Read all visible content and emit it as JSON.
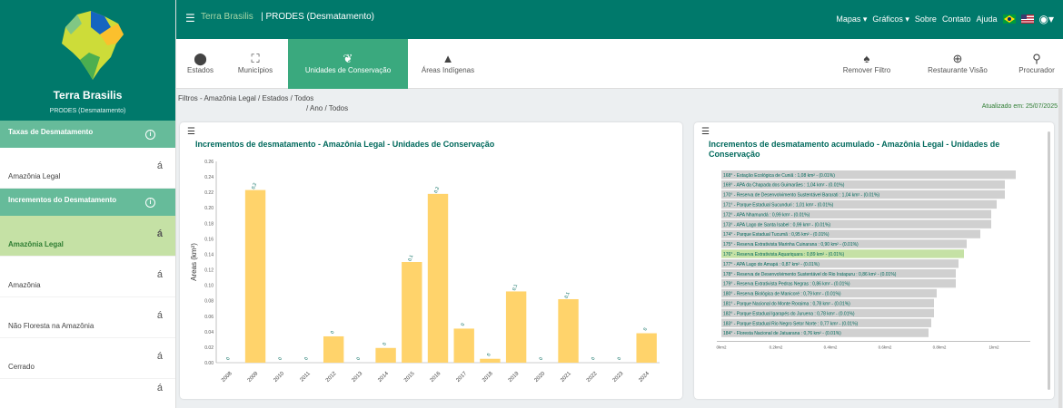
{
  "brand": {
    "name": "Terra Brasilis",
    "subtitle": "PRODES (Desmatamento)"
  },
  "topbar": {
    "title_part1": "Terra Brasilis",
    "title_part2": "| PRODES (Desmatamento)",
    "menu": [
      "Mapas ▾",
      "Gráficos ▾",
      "Sobre",
      "Contato",
      "Ajuda"
    ]
  },
  "toolbar": {
    "left": [
      {
        "icon": "pin-icon",
        "label": "Estados"
      },
      {
        "icon": "municipality-icon",
        "label": "Municípios"
      },
      {
        "icon": "leaf-icon",
        "label": "Unidades de Conservação"
      },
      {
        "icon": "tent-icon",
        "label": "Áreas Indígenas"
      }
    ],
    "right": [
      {
        "icon": "bell-icon",
        "label": "Remover Filtro"
      },
      {
        "icon": "globe-icon",
        "label": "Restaurante Visão"
      },
      {
        "icon": "search-icon",
        "label": "Procurador"
      }
    ]
  },
  "filters": {
    "line1": "Filtros - Amazônia Legal / Estados / Todos",
    "line2": "/ Ano / Todos",
    "updated": "Atualizado em: 25/07/2025"
  },
  "sidebar": {
    "section1": "Taxas de Desmatamento",
    "section1_items": [
      "Amazônia Legal"
    ],
    "section2": "Incrementos do Desmatamento",
    "section2_items": [
      "Amazônia Legal",
      "Amazônia",
      "Não Floresta na Amazônia",
      "Cerrado"
    ],
    "acc": "á"
  },
  "chart_data": [
    {
      "type": "bar",
      "title": "Incrementos de desmatamento - Amazônia Legal - Unidades de Conservação",
      "ylabel": "Areas (km²)",
      "ylim": [
        0,
        0.26
      ],
      "yticks": [
        "0.00",
        "0.02",
        "0.04",
        "0.06",
        "0.08",
        "0.10",
        "0.12",
        "0.14",
        "0.16",
        "0.18",
        "0.20",
        "0.22",
        "0.24",
        "0.26"
      ],
      "categories": [
        "2008",
        "2009",
        "2010",
        "2011",
        "2012",
        "2013",
        "2014",
        "2015",
        "2016",
        "2017",
        "2018",
        "2019",
        "2020",
        "2021",
        "2022",
        "2023",
        "2024"
      ],
      "values": [
        0,
        0.223,
        0,
        0,
        0.034,
        0,
        0.019,
        0.13,
        0.218,
        0.044,
        0.005,
        0.092,
        0,
        0.082,
        0,
        0,
        0.038
      ],
      "data_labels": [
        "0",
        "0,2",
        "0",
        "0",
        "0",
        "0",
        "0",
        "0,1",
        "0,2",
        "0",
        "0",
        "0,1",
        "0",
        "0,1",
        "0",
        "0",
        "0"
      ]
    },
    {
      "type": "bar",
      "orientation": "horizontal",
      "title": "Incrementos de desmatamento acumulado - Amazônia Legal - Unidades de Conservação",
      "categories": [
        "168° - Estação Ecológica de Cuniã : 1,08 km² - (0.01%)",
        "169° - APA da Chapada dos Guimarães : 1,04 km² - (0.01%)",
        "170° - Reserva de Desenvolvimento Sustentável Bararati : 1,04 km² - (0.01%)",
        "171° - Parque Estadual Sucunduri : 1,01 km² - (0.01%)",
        "172° - APA Nhamundá : 0,99 km² - (0.01%)",
        "173° - APA Lago de Santa Isabel : 0,99 km² - (0.01%)",
        "174° - Parque Estadual Tucumã : 0,95 km² - (0.01%)",
        "175° - Reserva Extrativista Marinha Cuinarana : 0,90 km² - (0.01%)",
        "176° - Reserva Extrativista Aquariquara : 0,89 km² - (0.01%)",
        "177° - APA Lago do Amapá : 0,87 km² - (0.01%)",
        "178° - Reserva de Desenvolvimento Sustentável do Rio Iratapuru : 0,86 km² - (0.01%)",
        "179° - Reserva Extrativista Pedras Negras : 0,86 km² - (0.01%)",
        "180° - Reserva Biológica de Manicoré : 0,79 km² - (0.01%)",
        "181° - Parque Nacional do Monte Roraima : 0,78 km² - (0.01%)",
        "182° - Parque Estadual Igarapés do Juruena : 0,78 km² - (0.01%)",
        "183° - Parque Estadual Rio Negro Setor Norte : 0,77 km² - (0.01%)",
        "184° - Floresta Nacional de Jatuarana : 0,76 km² - (0.01%)"
      ],
      "values": [
        1.08,
        1.04,
        1.04,
        1.01,
        0.99,
        0.99,
        0.95,
        0.9,
        0.89,
        0.87,
        0.86,
        0.86,
        0.79,
        0.78,
        0.78,
        0.77,
        0.76
      ],
      "highlight": "176° - Reserva Extrativista Aquariquara : 0,89 km² - (0.01%)",
      "xticks": [
        "0km2",
        "0.2km2",
        "0.4km2",
        "0.6km2",
        "0.8km2",
        "1km2"
      ],
      "xlim": [
        0,
        1.1
      ]
    }
  ]
}
